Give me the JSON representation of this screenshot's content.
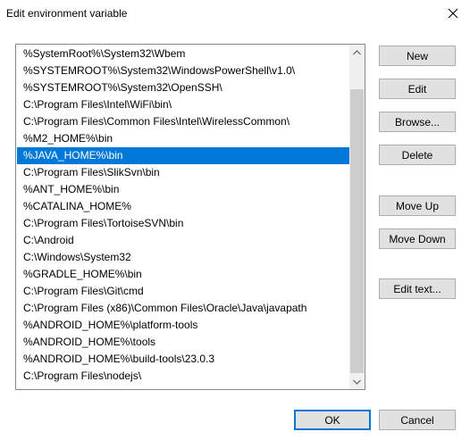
{
  "window": {
    "title": "Edit environment variable"
  },
  "list": {
    "items": [
      "%SystemRoot%\\System32\\Wbem",
      "%SYSTEMROOT%\\System32\\WindowsPowerShell\\v1.0\\",
      "%SYSTEMROOT%\\System32\\OpenSSH\\",
      "C:\\Program Files\\Intel\\WiFi\\bin\\",
      "C:\\Program Files\\Common Files\\Intel\\WirelessCommon\\",
      "%M2_HOME%\\bin",
      "%JAVA_HOME%\\bin",
      "C:\\Program Files\\SlikSvn\\bin",
      "%ANT_HOME%\\bin",
      "%CATALINA_HOME%",
      "C:\\Program Files\\TortoiseSVN\\bin",
      "C:\\Android",
      "C:\\Windows\\System32",
      "%GRADLE_HOME%\\bin",
      "C:\\Program Files\\Git\\cmd",
      "C:\\Program Files (x86)\\Common Files\\Oracle\\Java\\javapath",
      "%ANDROID_HOME%\\platform-tools",
      "%ANDROID_HOME%\\tools",
      "%ANDROID_HOME%\\build-tools\\23.0.3",
      "C:\\Program Files\\nodejs\\"
    ],
    "selected_index": 6
  },
  "buttons": {
    "new": "New",
    "edit": "Edit",
    "browse": "Browse...",
    "delete": "Delete",
    "move_up": "Move Up",
    "move_down": "Move Down",
    "edit_text": "Edit text...",
    "ok": "OK",
    "cancel": "Cancel"
  },
  "colors": {
    "selection": "#0078d7",
    "button_face": "#e1e1e1",
    "scroll_thumb": "#cdcdcd"
  },
  "icons": {
    "close": "close-icon",
    "scroll_up": "chevron-up-icon",
    "scroll_down": "chevron-down-icon"
  }
}
